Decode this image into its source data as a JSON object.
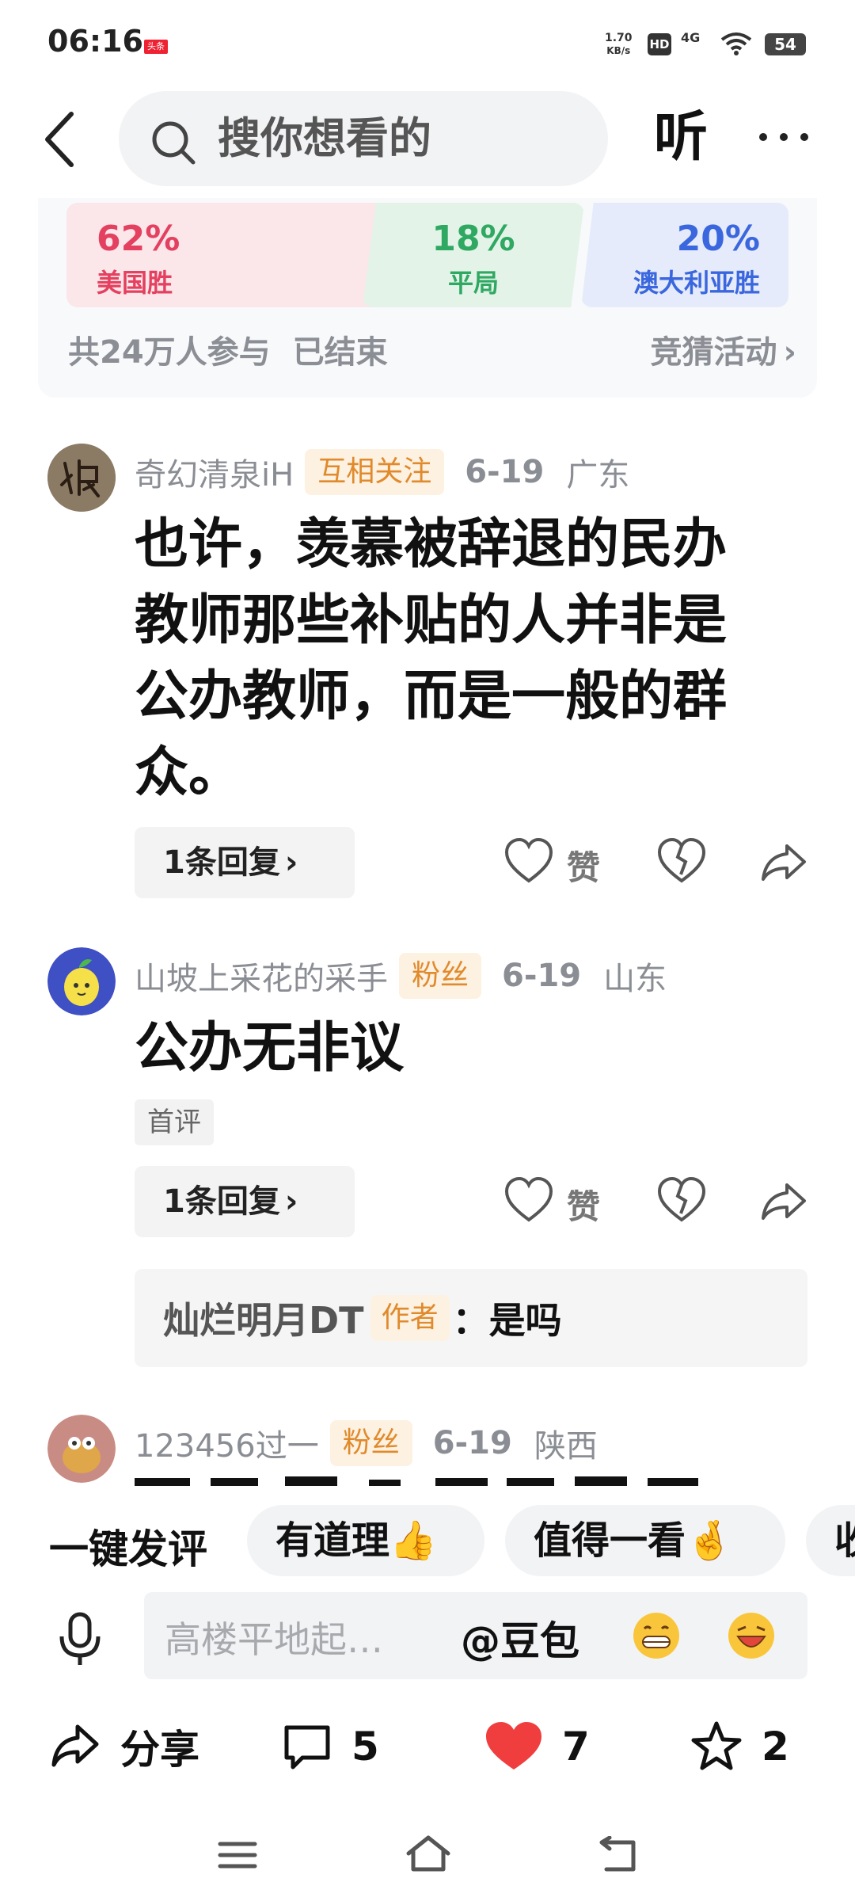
{
  "status_bar": {
    "time": "06:16",
    "app_badge": "头条",
    "net_speed": "1.70",
    "net_speed_unit": "KB/s",
    "hd": "HD",
    "signal": "4G",
    "battery": "54"
  },
  "header": {
    "search_placeholder": "搜你想看的",
    "listen_label": "听"
  },
  "vote": {
    "options": [
      {
        "percent": "62%",
        "label": "美国胜",
        "color": "#e4405f"
      },
      {
        "percent": "18%",
        "label": "平局",
        "color": "#2fa862"
      },
      {
        "percent": "20%",
        "label": "澳大利亚胜",
        "color": "#3b67de"
      }
    ],
    "participants": "共24万人参与",
    "status": "已结束",
    "link_label": "竞猜活动"
  },
  "comments": [
    {
      "user": "奇幻清泉iH",
      "tag": "互相关注",
      "date": "6-19",
      "location": "广东",
      "text": "也许，羡慕被辞退的民办教师那些补贴的人并非是公办教师，而是一般的群众。",
      "reply_count": "1条回复",
      "like_label": "赞"
    },
    {
      "user": "山坡上采花的采手",
      "tag": "粉丝",
      "date": "6-19",
      "location": "山东",
      "text": "公办无非议",
      "badge": "首评",
      "reply_count": "1条回复",
      "like_label": "赞",
      "author_reply": {
        "user": "灿烂明月DT",
        "tag": "作者",
        "text": "：是吗"
      }
    },
    {
      "user": "123456过一",
      "tag": "粉丝",
      "date": "6-19",
      "location": "陕西"
    }
  ],
  "quick_comments": {
    "label": "一键发评",
    "chips": [
      "有道理👍",
      "值得一看🤞",
      "收"
    ]
  },
  "input": {
    "placeholder": "高楼平地起…",
    "mention": "@豆包"
  },
  "actions": {
    "share_label": "分享",
    "comment_count": "5",
    "like_count": "7",
    "favorite_count": "2"
  },
  "colors": {
    "like_red": "#f03e3e",
    "tag_orange": "#e08a2c"
  },
  "icons": [
    "back-icon",
    "search-icon",
    "more-icon",
    "heart-icon",
    "broken-heart-icon",
    "share-arrow-icon",
    "mic-icon",
    "comment-icon",
    "star-icon",
    "menu-icon",
    "home-icon",
    "return-icon"
  ]
}
